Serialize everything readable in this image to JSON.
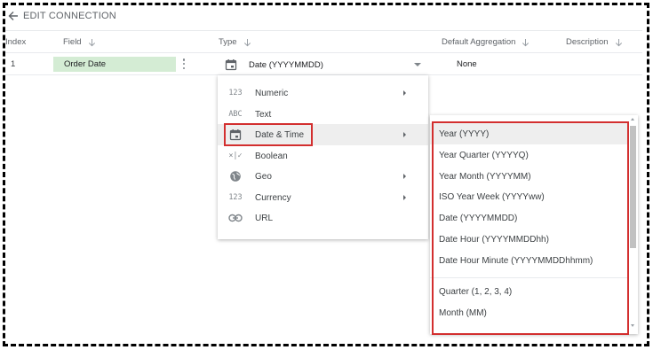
{
  "topbar": {
    "title": "EDIT CONNECTION",
    "back_icon": "arrow-left-icon"
  },
  "columns": {
    "index": "Index",
    "field": "Field",
    "type": "Type",
    "default_aggregation": "Default Aggregation",
    "description": "Description"
  },
  "row": {
    "index": "1",
    "field": "Order Date",
    "type": "Date (YYYYMMDD)",
    "aggregation": "None"
  },
  "type_menu": {
    "items": [
      {
        "icon": "123",
        "label": "Numeric",
        "submenu": true
      },
      {
        "icon": "ABC",
        "label": "Text",
        "submenu": false
      },
      {
        "icon": "calendar-icon",
        "label": "Date & Time",
        "submenu": true,
        "selected": true
      },
      {
        "icon": "×|✓",
        "label": "Boolean",
        "submenu": false
      },
      {
        "icon": "globe-icon",
        "label": "Geo",
        "submenu": true
      },
      {
        "icon": "123",
        "label": "Currency",
        "submenu": true
      },
      {
        "icon": "link-icon",
        "label": "URL",
        "submenu": false
      }
    ]
  },
  "date_submenu": {
    "items": [
      "Year (YYYY)",
      "Year Quarter (YYYYQ)",
      "Year Month (YYYYMM)",
      "ISO Year Week (YYYYww)",
      "Date (YYYYMMDD)",
      "Date Hour (YYYYMMDDhh)",
      "Date Hour Minute (YYYYMMDDhhmm)",
      "Quarter (1, 2, 3, 4)",
      "Month (MM)"
    ]
  },
  "colors": {
    "highlight": "#d32f2f",
    "field_chip": "#d4ecd4",
    "menu_hover": "#eeeeee"
  }
}
